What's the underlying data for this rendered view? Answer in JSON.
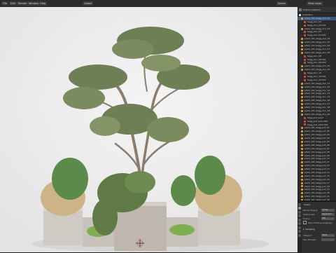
{
  "header": {
    "menu": [
      "File",
      "Edit",
      "Render",
      "Window",
      "Help"
    ],
    "scene_label": "Scene",
    "view_layer_label": "View Layer",
    "orientation_label": "Global"
  },
  "viewport": {
    "view_title": "User Perspective",
    "collection_label": "(1) Collection",
    "shading_options_label": "Options"
  },
  "outliner": {
    "header_label": "Scene Collection",
    "rows": [
      {
        "label": "Collection",
        "type": "collection"
      },
      {
        "label": "plant_191_Sagg_Anc_02",
        "type": "object"
      },
      {
        "label": "Sagg_Anc_02",
        "type": "mesh"
      },
      {
        "label": "Sagg_Anc_02.001",
        "type": "mesh"
      },
      {
        "label": "plant_191_Sagg_Anc_03",
        "type": "object"
      },
      {
        "label": "Sagg_Anc_03",
        "type": "mesh"
      },
      {
        "label": "Sagg_Anc_03.001",
        "type": "mesh"
      },
      {
        "label": "plant_191_Sagg_Anc_04",
        "type": "object"
      },
      {
        "label": "plant_191_Sagg_Anc_05",
        "type": "object"
      },
      {
        "label": "plant_191_Sagg_Anc_06",
        "type": "object"
      },
      {
        "label": "plant_191_Sagg_Anc_07",
        "type": "object"
      },
      {
        "label": "plant_191_Sagg_Anc_08",
        "type": "object"
      },
      {
        "label": "Sagg_Anc_08",
        "type": "mesh"
      },
      {
        "label": "Sagg_Anc_08.001",
        "type": "mesh"
      },
      {
        "label": "Sagg_Anc_08.002",
        "type": "mesh"
      },
      {
        "label": "plant_191_Sagg_Anc_09",
        "type": "object"
      },
      {
        "label": "plant_191_Sagg_Anc_10",
        "type": "object"
      },
      {
        "label": "Sagg_Anc_10",
        "type": "mesh"
      },
      {
        "label": "Sagg_Anc_10.001",
        "type": "mesh"
      },
      {
        "label": "Sagg_Anc_10.002",
        "type": "mesh"
      },
      {
        "label": "plant_191_Sagg_Anc_11",
        "type": "object"
      },
      {
        "label": "plant_191_Sagg_Anc_12",
        "type": "object"
      },
      {
        "label": "plant_191_Sagg_Anc_13",
        "type": "object"
      },
      {
        "label": "plant_191_Sagg_Anc_14",
        "type": "object"
      },
      {
        "label": "plant_191_Sagg_Anc_15",
        "type": "object"
      },
      {
        "label": "plant_191_Sagg_Anc_16",
        "type": "object"
      },
      {
        "label": "plant_191_Sagg_Anc_17",
        "type": "object"
      },
      {
        "label": "plant_191_Sagg_Anc_18",
        "type": "object"
      },
      {
        "label": "plant_191_Sagg_Anc_19",
        "type": "object"
      },
      {
        "label": "plant_191_Sagg_Anc_20",
        "type": "object"
      },
      {
        "label": "Sagg_pot_subd",
        "type": "mesh"
      },
      {
        "label": "Sagg_pot_subd.001",
        "type": "mesh"
      },
      {
        "label": "Sagg_pot_subd.002",
        "type": "mesh"
      },
      {
        "label": "plant_191_Sagg_pot_01",
        "type": "object"
      },
      {
        "label": "plant_191_Sagg_pot_02",
        "type": "object"
      },
      {
        "label": "plant_191_Sagg_pot_03",
        "type": "object"
      },
      {
        "label": "plant_191_Sagg_pot_04",
        "type": "object"
      },
      {
        "label": "plant_191_Sagg_pot_05",
        "type": "object"
      },
      {
        "label": "plant_191_Sagg_pot_06",
        "type": "object"
      },
      {
        "label": "plant_191_Sagg_pot_07",
        "type": "object"
      },
      {
        "label": "plant_191_Sagg_pot_08",
        "type": "object"
      },
      {
        "label": "plant_191_Sagg_pot_09",
        "type": "object"
      },
      {
        "label": "plant_191_Sagg_pot_10",
        "type": "object"
      },
      {
        "label": "plant_191_Sagg_pot_11",
        "type": "object"
      },
      {
        "label": "plant_191_Sagg_pot_12",
        "type": "object"
      },
      {
        "label": "plant_191_Sagg_pot_13",
        "type": "object"
      },
      {
        "label": "plant_191_Sagg_pot_14",
        "type": "object"
      },
      {
        "label": "plant_191_Sagg_pot_15",
        "type": "object"
      },
      {
        "label": "plant_191_Sagg_pot_16",
        "type": "object"
      },
      {
        "label": "plant_191_Sagg_pot_17",
        "type": "object"
      },
      {
        "label": "plant_191_Sagg_pot_18",
        "type": "object"
      },
      {
        "label": "plant_191_Sagg_pot_19",
        "type": "object"
      },
      {
        "label": "plant_191_Sagg_pot_20",
        "type": "object"
      },
      {
        "label": "plant_191_Sagg_pot_21",
        "type": "object"
      },
      {
        "label": "plant_191_Sagg_pot_22",
        "type": "object"
      }
    ]
  },
  "properties": {
    "title": "Scene",
    "rows": [
      {
        "label": "Render Engine",
        "value": "Cycles"
      },
      {
        "label": "Feature Set",
        "value": "Supported"
      },
      {
        "label": "Device",
        "value": "CPU"
      },
      {
        "label": "",
        "value": "Open Shading Language"
      },
      {
        "label": "Sampling",
        "value": ""
      },
      {
        "label": "Viewport",
        "value": "Noise Threshold"
      },
      {
        "label": "Max Samples",
        "value": ""
      }
    ]
  },
  "colors": {
    "object": "#e59a3a",
    "mesh": "#c4523a",
    "collection": "#eaeaea",
    "selected_row": "#3d5a80",
    "gizmo_x": "#e5484d",
    "gizmo_y": "#6fbf40",
    "gizmo_z": "#3f7be0"
  }
}
